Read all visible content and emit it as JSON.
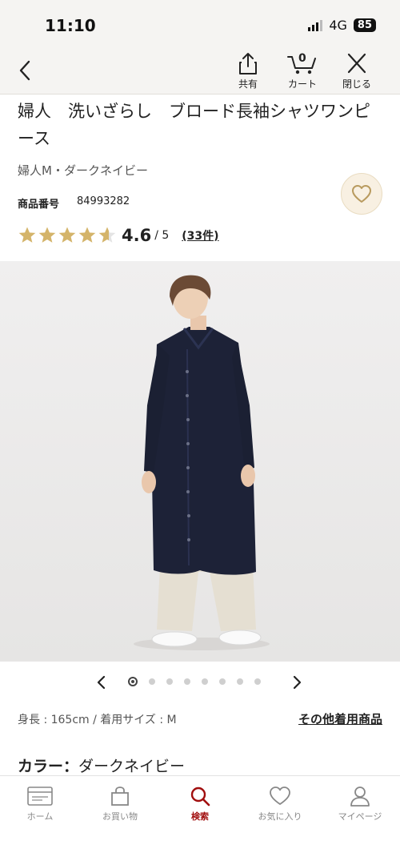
{
  "status": {
    "time": "11:10",
    "network": "4G",
    "battery": "85"
  },
  "nav": {
    "share_label": "共有",
    "cart_label": "カート",
    "cart_count": "0",
    "close_label": "閉じる"
  },
  "product": {
    "title": "婦人　洗いざらし　ブロード長袖シャツワンピース",
    "subtitle": "婦人M・ダークネイビー",
    "code_label": "商品番号",
    "code_value": "84993282",
    "rating_value": "4.6",
    "rating_max": "/ 5",
    "review_count": "(33件)",
    "rating": 4.6,
    "rating_out_of": 5
  },
  "carousel": {
    "total": 8,
    "active_index": 0
  },
  "model": {
    "info": "身長 : 165cm / 着用サイズ : M",
    "other_link": "その他着用商品"
  },
  "color": {
    "label": "カラー：",
    "value": "ダークネイビー"
  },
  "tabs": [
    {
      "label": "ホーム",
      "icon": "home-card-icon"
    },
    {
      "label": "お買い物",
      "icon": "shopping-bag-icon"
    },
    {
      "label": "検索",
      "icon": "search-icon"
    },
    {
      "label": "お気に入り",
      "icon": "heart-icon"
    },
    {
      "label": "マイページ",
      "icon": "person-icon"
    }
  ],
  "colors": {
    "accent": "#a10e0e",
    "star": "#d4b46a",
    "fav_bg": "#f8f0e2",
    "dress": "#1d2237"
  }
}
